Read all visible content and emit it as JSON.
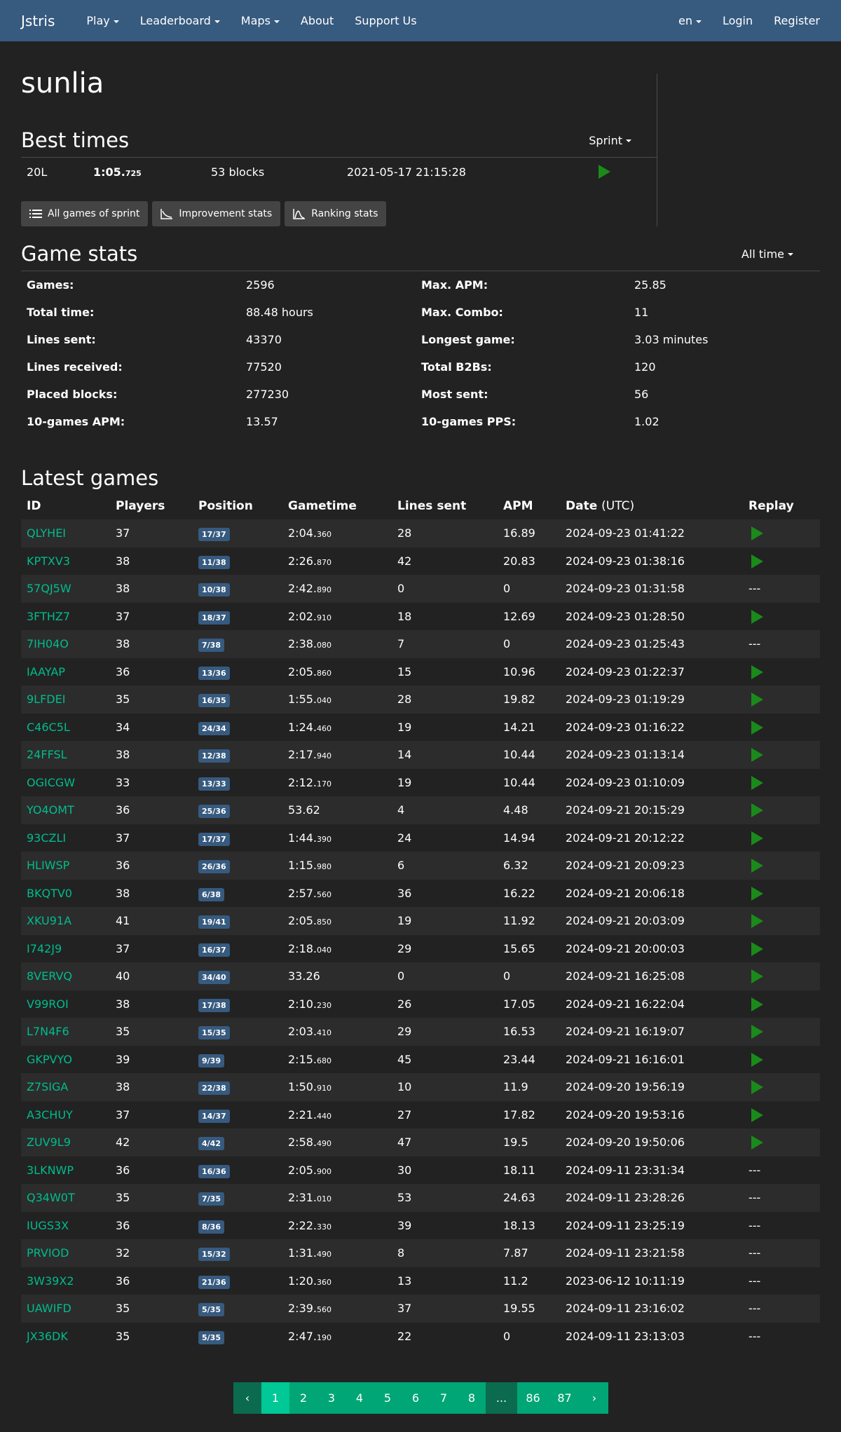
{
  "nav": {
    "brand": "Jstris",
    "play": "Play",
    "leaderboard": "Leaderboard",
    "maps": "Maps",
    "about": "About",
    "support": "Support Us",
    "lang": "en",
    "login": "Login",
    "register": "Register"
  },
  "username": "sunlia",
  "best_times": {
    "title": "Best times",
    "mode": "Sprint",
    "row": {
      "lines": "20L",
      "time_main": "1:05.",
      "time_ms": "725",
      "blocks": "53 blocks",
      "date": "2021-05-17 21:15:28"
    },
    "buttons": [
      "All games of sprint",
      "Improvement stats",
      "Ranking stats"
    ]
  },
  "game_stats": {
    "title": "Game stats",
    "period": "All time",
    "left": [
      {
        "label": "Games:",
        "value": "2596"
      },
      {
        "label": "Total time:",
        "value": "88.48 hours"
      },
      {
        "label": "Lines sent:",
        "value": "43370"
      },
      {
        "label": "Lines received:",
        "value": "77520"
      },
      {
        "label": "Placed blocks:",
        "value": "277230"
      },
      {
        "label": "10-games APM:",
        "value": "13.57"
      }
    ],
    "right": [
      {
        "label": "Max. APM:",
        "value": "25.85"
      },
      {
        "label": "Max. Combo:",
        "value": "11"
      },
      {
        "label": "Longest game:",
        "value": "3.03 minutes"
      },
      {
        "label": "Total B2Bs:",
        "value": "120"
      },
      {
        "label": "Most sent:",
        "value": "56"
      },
      {
        "label": "10-games PPS:",
        "value": "1.02"
      }
    ]
  },
  "latest": {
    "title": "Latest games",
    "headers": {
      "id": "ID",
      "players": "Players",
      "position": "Position",
      "gametime": "Gametime",
      "lines": "Lines sent",
      "apm": "APM",
      "date": "Date",
      "utc": "(UTC)",
      "replay": "Replay"
    },
    "rows": [
      {
        "id": "QLYHEI",
        "players": "37",
        "pos": "17/37",
        "t": "2:04.",
        "ms": "360",
        "lines": "28",
        "apm": "16.89",
        "date": "2024-09-23 01:41:22",
        "replay": true
      },
      {
        "id": "KPTXV3",
        "players": "38",
        "pos": "11/38",
        "t": "2:26.",
        "ms": "870",
        "lines": "42",
        "apm": "20.83",
        "date": "2024-09-23 01:38:16",
        "replay": true
      },
      {
        "id": "57QJ5W",
        "players": "38",
        "pos": "10/38",
        "t": "2:42.",
        "ms": "890",
        "lines": "0",
        "apm": "0",
        "date": "2024-09-23 01:31:58",
        "replay": false
      },
      {
        "id": "3FTHZ7",
        "players": "37",
        "pos": "18/37",
        "t": "2:02.",
        "ms": "910",
        "lines": "18",
        "apm": "12.69",
        "date": "2024-09-23 01:28:50",
        "replay": true
      },
      {
        "id": "7IH04O",
        "players": "38",
        "pos": "7/38",
        "t": "2:38.",
        "ms": "080",
        "lines": "7",
        "apm": "0",
        "date": "2024-09-23 01:25:43",
        "replay": false
      },
      {
        "id": "IAAYAP",
        "players": "36",
        "pos": "13/36",
        "t": "2:05.",
        "ms": "860",
        "lines": "15",
        "apm": "10.96",
        "date": "2024-09-23 01:22:37",
        "replay": true
      },
      {
        "id": "9LFDEI",
        "players": "35",
        "pos": "16/35",
        "t": "1:55.",
        "ms": "040",
        "lines": "28",
        "apm": "19.82",
        "date": "2024-09-23 01:19:29",
        "replay": true
      },
      {
        "id": "C46C5L",
        "players": "34",
        "pos": "24/34",
        "t": "1:24.",
        "ms": "460",
        "lines": "19",
        "apm": "14.21",
        "date": "2024-09-23 01:16:22",
        "replay": true
      },
      {
        "id": "24FFSL",
        "players": "38",
        "pos": "12/38",
        "t": "2:17.",
        "ms": "940",
        "lines": "14",
        "apm": "10.44",
        "date": "2024-09-23 01:13:14",
        "replay": true
      },
      {
        "id": "OGICGW",
        "players": "33",
        "pos": "13/33",
        "t": "2:12.",
        "ms": "170",
        "lines": "19",
        "apm": "10.44",
        "date": "2024-09-23 01:10:09",
        "replay": true
      },
      {
        "id": "YO4OMT",
        "players": "36",
        "pos": "25/36",
        "t": "53.62",
        "ms": "",
        "lines": "4",
        "apm": "4.48",
        "date": "2024-09-21 20:15:29",
        "replay": true
      },
      {
        "id": "93CZLI",
        "players": "37",
        "pos": "17/37",
        "t": "1:44.",
        "ms": "390",
        "lines": "24",
        "apm": "14.94",
        "date": "2024-09-21 20:12:22",
        "replay": true
      },
      {
        "id": "HLIWSP",
        "players": "36",
        "pos": "26/36",
        "t": "1:15.",
        "ms": "980",
        "lines": "6",
        "apm": "6.32",
        "date": "2024-09-21 20:09:23",
        "replay": true
      },
      {
        "id": "BKQTV0",
        "players": "38",
        "pos": "6/38",
        "t": "2:57.",
        "ms": "560",
        "lines": "36",
        "apm": "16.22",
        "date": "2024-09-21 20:06:18",
        "replay": true
      },
      {
        "id": "XKU91A",
        "players": "41",
        "pos": "19/41",
        "t": "2:05.",
        "ms": "850",
        "lines": "19",
        "apm": "11.92",
        "date": "2024-09-21 20:03:09",
        "replay": true
      },
      {
        "id": "I742J9",
        "players": "37",
        "pos": "16/37",
        "t": "2:18.",
        "ms": "040",
        "lines": "29",
        "apm": "15.65",
        "date": "2024-09-21 20:00:03",
        "replay": true
      },
      {
        "id": "8VERVQ",
        "players": "40",
        "pos": "34/40",
        "t": "33.26",
        "ms": "",
        "lines": "0",
        "apm": "0",
        "date": "2024-09-21 16:25:08",
        "replay": true
      },
      {
        "id": "V99ROI",
        "players": "38",
        "pos": "17/38",
        "t": "2:10.",
        "ms": "230",
        "lines": "26",
        "apm": "17.05",
        "date": "2024-09-21 16:22:04",
        "replay": true
      },
      {
        "id": "L7N4F6",
        "players": "35",
        "pos": "15/35",
        "t": "2:03.",
        "ms": "410",
        "lines": "29",
        "apm": "16.53",
        "date": "2024-09-21 16:19:07",
        "replay": true
      },
      {
        "id": "GKPVYO",
        "players": "39",
        "pos": "9/39",
        "t": "2:15.",
        "ms": "680",
        "lines": "45",
        "apm": "23.44",
        "date": "2024-09-21 16:16:01",
        "replay": true
      },
      {
        "id": "Z7SIGA",
        "players": "38",
        "pos": "22/38",
        "t": "1:50.",
        "ms": "910",
        "lines": "10",
        "apm": "11.9",
        "date": "2024-09-20 19:56:19",
        "replay": true
      },
      {
        "id": "A3CHUY",
        "players": "37",
        "pos": "14/37",
        "t": "2:21.",
        "ms": "440",
        "lines": "27",
        "apm": "17.82",
        "date": "2024-09-20 19:53:16",
        "replay": true
      },
      {
        "id": "ZUV9L9",
        "players": "42",
        "pos": "4/42",
        "t": "2:58.",
        "ms": "490",
        "lines": "47",
        "apm": "19.5",
        "date": "2024-09-20 19:50:06",
        "replay": true
      },
      {
        "id": "3LKNWP",
        "players": "36",
        "pos": "16/36",
        "t": "2:05.",
        "ms": "900",
        "lines": "30",
        "apm": "18.11",
        "date": "2024-09-11 23:31:34",
        "replay": false
      },
      {
        "id": "Q34W0T",
        "players": "35",
        "pos": "7/35",
        "t": "2:31.",
        "ms": "010",
        "lines": "53",
        "apm": "24.63",
        "date": "2024-09-11 23:28:26",
        "replay": false
      },
      {
        "id": "IUGS3X",
        "players": "36",
        "pos": "8/36",
        "t": "2:22.",
        "ms": "330",
        "lines": "39",
        "apm": "18.13",
        "date": "2024-09-11 23:25:19",
        "replay": false
      },
      {
        "id": "PRVIOD",
        "players": "32",
        "pos": "15/32",
        "t": "1:31.",
        "ms": "490",
        "lines": "8",
        "apm": "7.87",
        "date": "2024-09-11 23:21:58",
        "replay": false
      },
      {
        "id": "3W39X2",
        "players": "36",
        "pos": "21/36",
        "t": "1:20.",
        "ms": "360",
        "lines": "13",
        "apm": "11.2",
        "date": "2023-06-12 10:11:19",
        "replay": false
      },
      {
        "id": "UAWIFD",
        "players": "35",
        "pos": "5/35",
        "t": "2:39.",
        "ms": "560",
        "lines": "37",
        "apm": "19.55",
        "date": "2024-09-11 23:16:02",
        "replay": false
      },
      {
        "id": "JX36DK",
        "players": "35",
        "pos": "5/35",
        "t": "2:47.",
        "ms": "190",
        "lines": "22",
        "apm": "0",
        "date": "2024-09-11 23:13:03",
        "replay": false
      }
    ],
    "no_replay": "---"
  },
  "pagination": {
    "prev": "‹",
    "pages": [
      "1",
      "2",
      "3",
      "4",
      "5",
      "6",
      "7",
      "8"
    ],
    "ellipsis": "...",
    "last_pages": [
      "86",
      "87"
    ],
    "next": "›",
    "active": "1"
  }
}
